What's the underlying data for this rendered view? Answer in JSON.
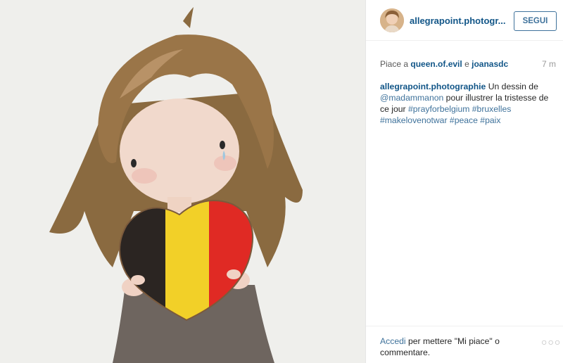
{
  "post": {
    "username": "allegrapoint.photogr...",
    "follow_label": "SEGUI",
    "likes_prefix": "Piace a",
    "liker1": "queen.of.evil",
    "likes_and": "e",
    "liker2": "joanasdc",
    "time_ago": "7 m",
    "caption_user": "allegrapoint.photographie",
    "caption_t1": "Un dessin de",
    "caption_mention": "@madammanon",
    "caption_t2": "pour illustrer la tristesse de ce jour",
    "hashtags": [
      "#prayforbelgium",
      "#bruxelles",
      "#makelovenotwar",
      "#peace",
      "#paix"
    ],
    "login_link": "Accedi",
    "login_text": "per mettere \"Mi piace\" o commentare.",
    "more_glyph": "○○○"
  },
  "icons": [
    "avatar",
    "more-options-icon"
  ],
  "colors": {
    "link_dark": "#125688",
    "link": "#3f729b",
    "text": "#262626",
    "muted": "#9a9a9a"
  }
}
